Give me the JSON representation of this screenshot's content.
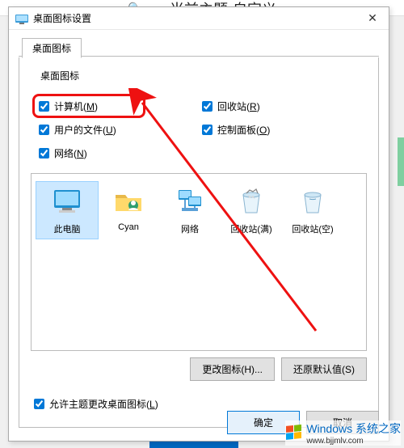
{
  "background": {
    "header_text": "当前主题·自定义",
    "search_icon": "search-icon"
  },
  "dialog": {
    "title": "桌面图标设置",
    "close_label": "✕",
    "tabs": [
      {
        "label": "桌面图标"
      }
    ],
    "group_label": "桌面图标",
    "checkboxes": {
      "computer": {
        "label": "计算机",
        "hotkey": "M",
        "checked": true
      },
      "recycle": {
        "label": "回收站",
        "hotkey": "R",
        "checked": true
      },
      "userfiles": {
        "label": "用户的文件",
        "hotkey": "U",
        "checked": true
      },
      "control": {
        "label": "控制面板",
        "hotkey": "O",
        "checked": true
      },
      "network": {
        "label": "网络",
        "hotkey": "N",
        "checked": true
      }
    },
    "icons": [
      {
        "id": "this-pc",
        "label": "此电脑",
        "selected": true
      },
      {
        "id": "user-folder",
        "label": "Cyan",
        "selected": false
      },
      {
        "id": "network",
        "label": "网络",
        "selected": false
      },
      {
        "id": "recycle-full",
        "label": "回收站(满)",
        "selected": false
      },
      {
        "id": "recycle-empty",
        "label": "回收站(空)",
        "selected": false
      }
    ],
    "buttons": {
      "change_icon": "更改图标(H)...",
      "restore_default": "还原默认值(S)"
    },
    "allow_theme": {
      "label": "允许主题更改桌面图标",
      "hotkey": "L",
      "checked": true
    },
    "footer": {
      "ok": "确定",
      "cancel": "取消"
    }
  },
  "watermark": {
    "line1": "Windows 系统之家",
    "line2": "www.bjjmlv.com"
  },
  "colors": {
    "highlight": "#e11",
    "primary": "#0078d7"
  }
}
